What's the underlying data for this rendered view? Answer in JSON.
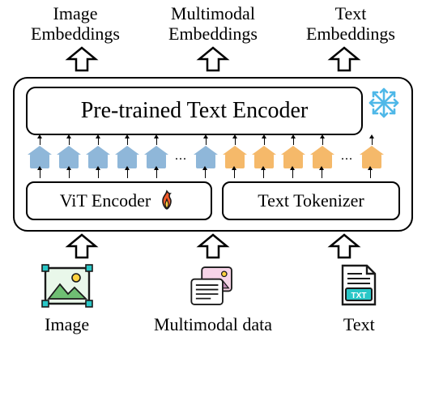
{
  "outputs": {
    "image": "Image\nEmbeddings",
    "multimodal": "Multimodal\nEmbeddings",
    "text": "Text\nEmbeddings"
  },
  "model": {
    "text_encoder_label": "Pre-trained Text Encoder",
    "text_encoder_frozen": true,
    "vit_label": "ViT Encoder",
    "vit_trainable": true,
    "tokenizer_label": "Text Tokenizer",
    "image_tokens": {
      "count": 6,
      "ellipsis": true,
      "color": "#8fb7d9"
    },
    "text_tokens": {
      "count": 5,
      "ellipsis": true,
      "color": "#f5b96a"
    }
  },
  "inputs": {
    "image": "Image",
    "multimodal": "Multimodal data",
    "text": "Text"
  },
  "icons": {
    "snowflake": "snowflake-icon",
    "fire": "fire-icon",
    "image": "image-icon",
    "multimodal": "multimodal-icon",
    "text": "text-icon",
    "up_arrow": "up-arrow-icon"
  },
  "dots": "..."
}
